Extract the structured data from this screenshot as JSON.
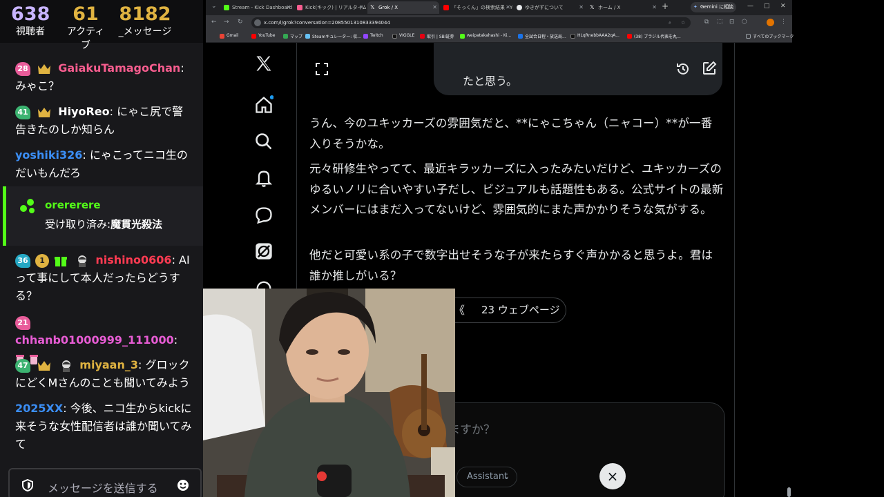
{
  "stats": {
    "viewers": "638",
    "viewers_label": "視聴者",
    "active": "61",
    "active_label": "アクティブ",
    "messages": "8182",
    "messages_label": "_メッセージ"
  },
  "chat": {
    "messages": [
      {
        "badge": "28",
        "user": "GaiakuTamagoChan",
        "user_color": "#f75d8f",
        "text": ": みゃこ？"
      },
      {
        "badge": "41",
        "user": "HiyoReo",
        "user_color": "#ffffff",
        "text": ": にゃこ尻で警告きたのしか知らん"
      },
      {
        "user": "yoshiki326",
        "user_color": "#3b8ef5",
        "text": ": にゃこってニコ生のだいもんだろ"
      },
      {
        "user": "orererere",
        "user_color": "#53fc18",
        "text": "受け取り済み:",
        "reward": "魔貫光殺法"
      },
      {
        "badge": "36",
        "sub_badge": "1",
        "user": "nishino0606",
        "user_color": "#ff3b52",
        "text": ": AIって事にして本人だったらどうする？"
      },
      {
        "badge": "21",
        "user": "chhanb01000999_111000",
        "user_color": "#e85cd5",
        "text": ":"
      },
      {
        "badge": "47",
        "user": "miyaan_3",
        "user_color": "#e0b341",
        "text": ": グロックにどくMさんのことも聞いてみよう"
      },
      {
        "user": "2025XX",
        "user_color": "#3b8ef5",
        "text": ": 今後、ニコ生からkickに来そうな女性配信者は誰か聞いてみて"
      }
    ],
    "input_placeholder": "メッセージを送信する"
  },
  "browser": {
    "tabs": [
      {
        "label": "Stream - Kick Dashboard",
        "color": "#53fc18"
      },
      {
        "label": "Kick(キック) | リアルタイム配信",
        "color": "#f75d8f"
      },
      {
        "label": "Grok / X",
        "color": "#ffffff"
      },
      {
        "label": "「そっくん」の検索結果 - Yo",
        "color": "#ff0000"
      },
      {
        "label": "ゆきがずについて",
        "color": "#ffffff"
      },
      {
        "label": "ホーム / X",
        "color": "#ffffff"
      }
    ],
    "gemini_label": "Gemini に相談",
    "url": "x.com/i/grok?conversation=2085501310833394044",
    "bookmarks": [
      {
        "label": "Gmail",
        "color": "#ea4335"
      },
      {
        "label": "YouTube",
        "color": "#ff0000"
      },
      {
        "label": "マップ",
        "color": "#34a853"
      },
      {
        "label": "Steamキュレーター: 収...",
        "color": "#1b2838"
      },
      {
        "label": "Twitch",
        "color": "#9146ff"
      },
      {
        "label": "VIGGLE",
        "color": "#000000"
      },
      {
        "label": "取引 | SBI証券",
        "color": "#e50012"
      },
      {
        "label": "weipatakahashi - Ki...",
        "color": "#53fc18"
      },
      {
        "label": "全試合日程・放送局...",
        "color": "#1a73e8"
      },
      {
        "label": "HLqRnebbAAA2qA...",
        "color": "#000000"
      },
      {
        "label": "(38) ブラジル代表を丸...",
        "color": "#ff0000"
      },
      {
        "label": "すべてのブックマーク",
        "color": "#9aa0a6"
      }
    ]
  },
  "grok": {
    "prev_bubble_text": "たと思う。",
    "paragraphs": [
      "うん、今のユキッカーズの雰囲気だと、**にゃこちゃん（ニャコー）**が一番入りそうかな。",
      "元々研修生やってて、最近キラッカーズに入ったみたいだけど、ユキッカーズのゆるいノリに合いやすい子だし、ビジュアルも話題性もある。公式サイトの最新メンバーにはまだ入ってないけど、雰囲気的にまた声かかりそうな気がする。",
      "他だと可愛い系の子で数字出せそうな子が来たらすぐ声かかると思うよ。君は誰か推しがいる？"
    ],
    "sources_label": "23 ウェブページ",
    "composer_placeholder": "ますか？",
    "model_label": "Assistant",
    "stop_icon": "×"
  }
}
